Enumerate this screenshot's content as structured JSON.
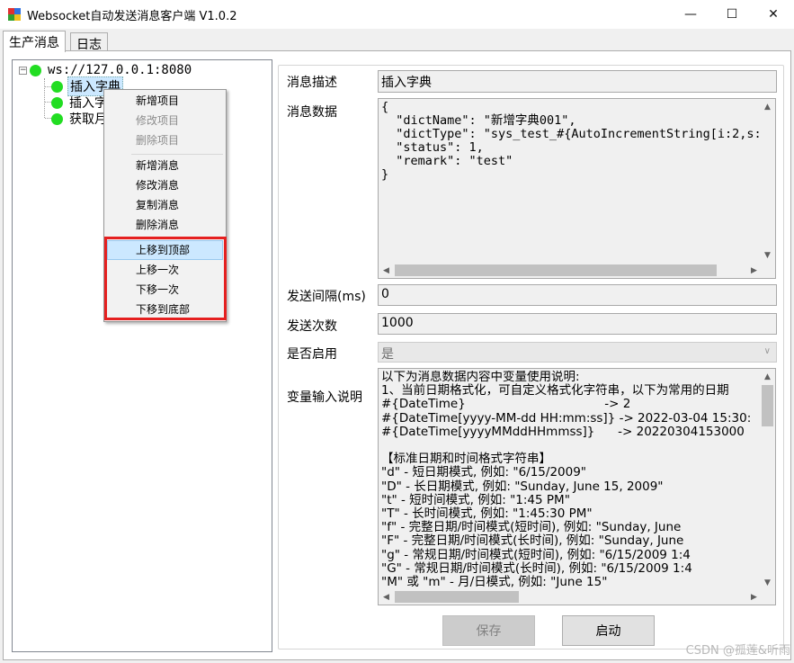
{
  "window": {
    "title": "Websocket自动发送消息客户端 V1.0.2",
    "minimize": "—",
    "maximize": "☐",
    "close": "✕"
  },
  "tabs": [
    {
      "label": "生产消息",
      "active": true
    },
    {
      "label": "日志",
      "active": false
    }
  ],
  "tree": {
    "root": {
      "label": "ws://127.0.0.1:8080",
      "toggle": "−"
    },
    "children": [
      {
        "label": "插入字典",
        "selected": true
      },
      {
        "label": "插入字"
      },
      {
        "label": "获取月"
      }
    ],
    "status_color": "#22dd22"
  },
  "context_menu": {
    "items": [
      {
        "label": "新增项目",
        "enabled": true
      },
      {
        "label": "修改项目",
        "enabled": false
      },
      {
        "label": "删除项目",
        "enabled": false
      },
      {
        "label": "新增消息",
        "enabled": true
      },
      {
        "label": "修改消息",
        "enabled": true
      },
      {
        "label": "复制消息",
        "enabled": true
      },
      {
        "label": "删除消息",
        "enabled": true
      },
      {
        "label": "上移到顶部",
        "enabled": true,
        "hover": true
      },
      {
        "label": "上移一次",
        "enabled": true
      },
      {
        "label": "下移一次",
        "enabled": true
      },
      {
        "label": "下移到底部",
        "enabled": true
      }
    ],
    "highlight_color": "#e52020"
  },
  "form": {
    "desc_label": "消息描述",
    "desc_value": "插入字典",
    "data_label": "消息数据",
    "data_value": "{\n  \"dictName\": \"新增字典001\",\n  \"dictType\": \"sys_test_#{AutoIncrementString[i:2,s:1\n  \"status\": 1,\n  \"remark\": \"test\"\n}",
    "interval_label": "发送间隔(ms)",
    "interval_value": "0",
    "count_label": "发送次数",
    "count_value": "1000",
    "enabled_label": "是否启用",
    "enabled_value": "是",
    "vars_label": "变量输入说明",
    "vars_value": "以下为消息数据内容中变量使用说明:\n1、当前日期格式化，可自定义格式化字符串，以下为常用的日期\n#{DateTime}                                    -> 2\n#{DateTime[yyyy-MM-dd HH:mm:ss]} -> 2022-03-04 15:30:\n#{DateTime[yyyyMMddHHmmss]}      -> 20220304153000\n\n【标准日期和时间格式字符串】\n\"d\" - 短日期模式, 例如: \"6/15/2009\"\n\"D\" - 长日期模式, 例如: \"Sunday, June 15, 2009\"\n\"t\" - 短时间模式, 例如: \"1:45 PM\"\n\"T\" - 长时间模式, 例如: \"1:45:30 PM\"\n\"f\" - 完整日期/时间模式(短时间), 例如: \"Sunday, June\n\"F\" - 完整日期/时间模式(长时间), 例如: \"Sunday, June\n\"g\" - 常规日期/时间模式(短时间), 例如: \"6/15/2009 1:4\n\"G\" - 常规日期/时间模式(长时间), 例如: \"6/15/2009 1:4\n\"M\" 或 \"m\" - 月/日模式, 例如: \"June 15\""
  },
  "buttons": {
    "save": "保存",
    "start": "启动"
  },
  "watermark": "CSDN @孤莲&听雨"
}
